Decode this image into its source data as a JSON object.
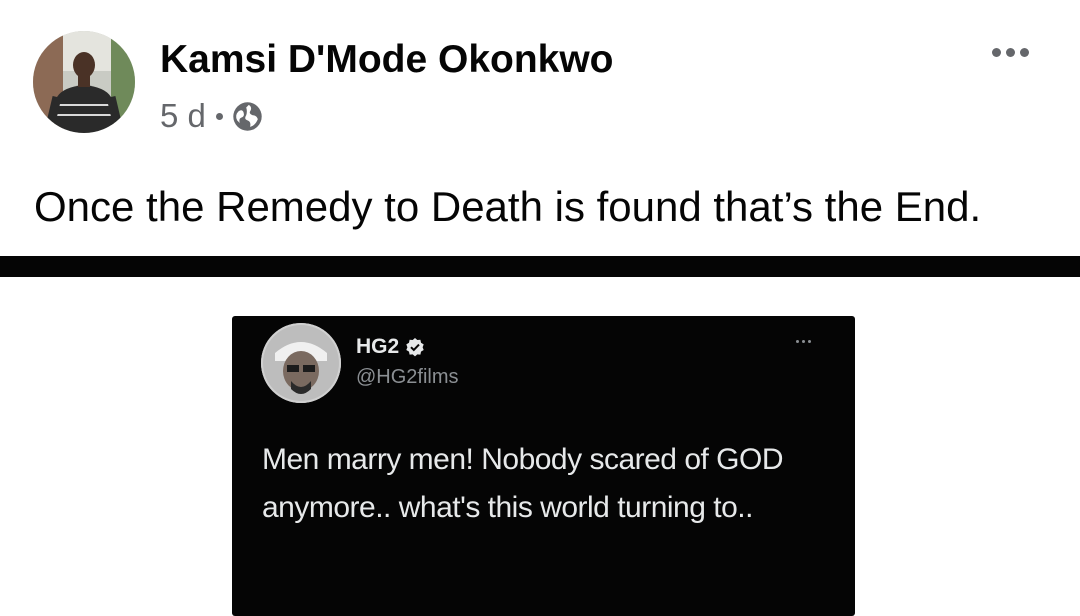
{
  "post": {
    "author_name": "Kamsi D'Mode Okonkwo",
    "time": "5 d",
    "privacy_icon": "globe-icon",
    "more_icon": "more-horizontal-icon",
    "text": "Once the Remedy to Death is found that’s the End."
  },
  "tweet": {
    "name": "HG2",
    "verified_icon": "verified-badge-icon",
    "handle": "@HG2films",
    "more_icon": "more-horizontal-icon",
    "text": "Men marry men! Nobody scared of GOD anymore.. what's this world turning to.."
  },
  "colors": {
    "text_primary": "#050505",
    "text_secondary": "#65676b",
    "tweet_background": "#050505",
    "tweet_text": "#e7e9ea",
    "tweet_handle": "#8b8f93"
  }
}
